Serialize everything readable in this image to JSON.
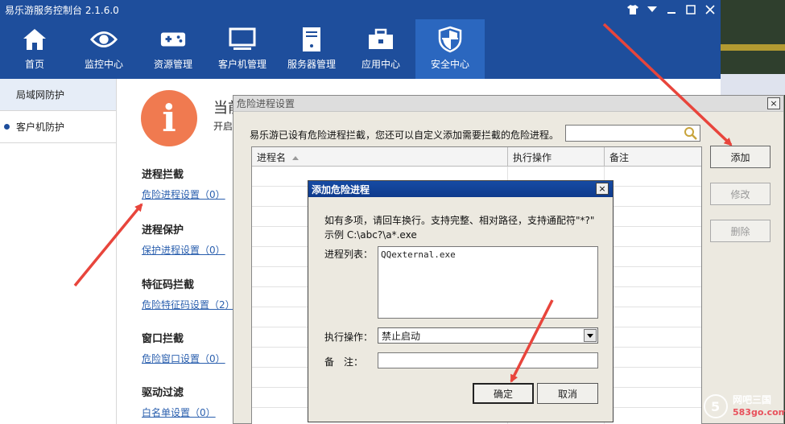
{
  "app": {
    "title": "易乐游服务控制台 2.1.6.0"
  },
  "nav": {
    "items": [
      {
        "label": "首页",
        "icon": "home-icon"
      },
      {
        "label": "监控中心",
        "icon": "eye-icon"
      },
      {
        "label": "资源管理",
        "icon": "gamepad-icon"
      },
      {
        "label": "客户机管理",
        "icon": "monitor-icon"
      },
      {
        "label": "服务器管理",
        "icon": "server-icon"
      },
      {
        "label": "应用中心",
        "icon": "toolbox-icon"
      },
      {
        "label": "安全中心",
        "icon": "shield-icon"
      }
    ],
    "active_index": 6
  },
  "sidebar": {
    "items": [
      {
        "label": "局域网防护"
      },
      {
        "label": "客户机防护"
      }
    ]
  },
  "main": {
    "status_title": "当前",
    "status_sub": "开启",
    "sections": [
      {
        "title": "进程拦截",
        "link": "危险进程设置（0）"
      },
      {
        "title": "进程保护",
        "link": "保护进程设置（0）"
      },
      {
        "title": "特征码拦截",
        "link": "危险特征码设置（2）"
      },
      {
        "title": "窗口拦截",
        "link": "危险窗口设置（0）"
      },
      {
        "title": "驱动过滤",
        "link": "白名单设置（0）"
      }
    ]
  },
  "dialog1": {
    "title": "危险进程设置",
    "close": "×",
    "description": "易乐游已设有危险进程拦截，您还可以自定义添加需要拦截的危险进程。",
    "search_value": "",
    "columns": [
      "进程名",
      "执行操作",
      "备注"
    ],
    "buttons": {
      "add": "添加",
      "edit": "修改",
      "delete": "删除"
    }
  },
  "dialog2": {
    "title": "添加危险进程",
    "close": "×",
    "hint1": "如有多项，请回车换行。支持完整、相对路径，支持通配符\"*?\"",
    "hint2": "示例 C:\\abc?\\a*.exe",
    "process_list_label": "进程列表：",
    "process_list_value": "QQexternal.exe",
    "action_label": "执行操作：",
    "action_value": "禁止启动",
    "remark_label": "备　注：",
    "remark_value": "",
    "ok": "确定",
    "cancel": "取消"
  },
  "watermark": {
    "name": "网吧三国",
    "url": "583go.com"
  },
  "colors": {
    "header": "#1e4e9c",
    "nav_active": "#2b67bf",
    "info_circle": "#f07a50",
    "arrow": "#e8453c",
    "link": "#2a5fae",
    "dialog_title": "#164ba4"
  }
}
